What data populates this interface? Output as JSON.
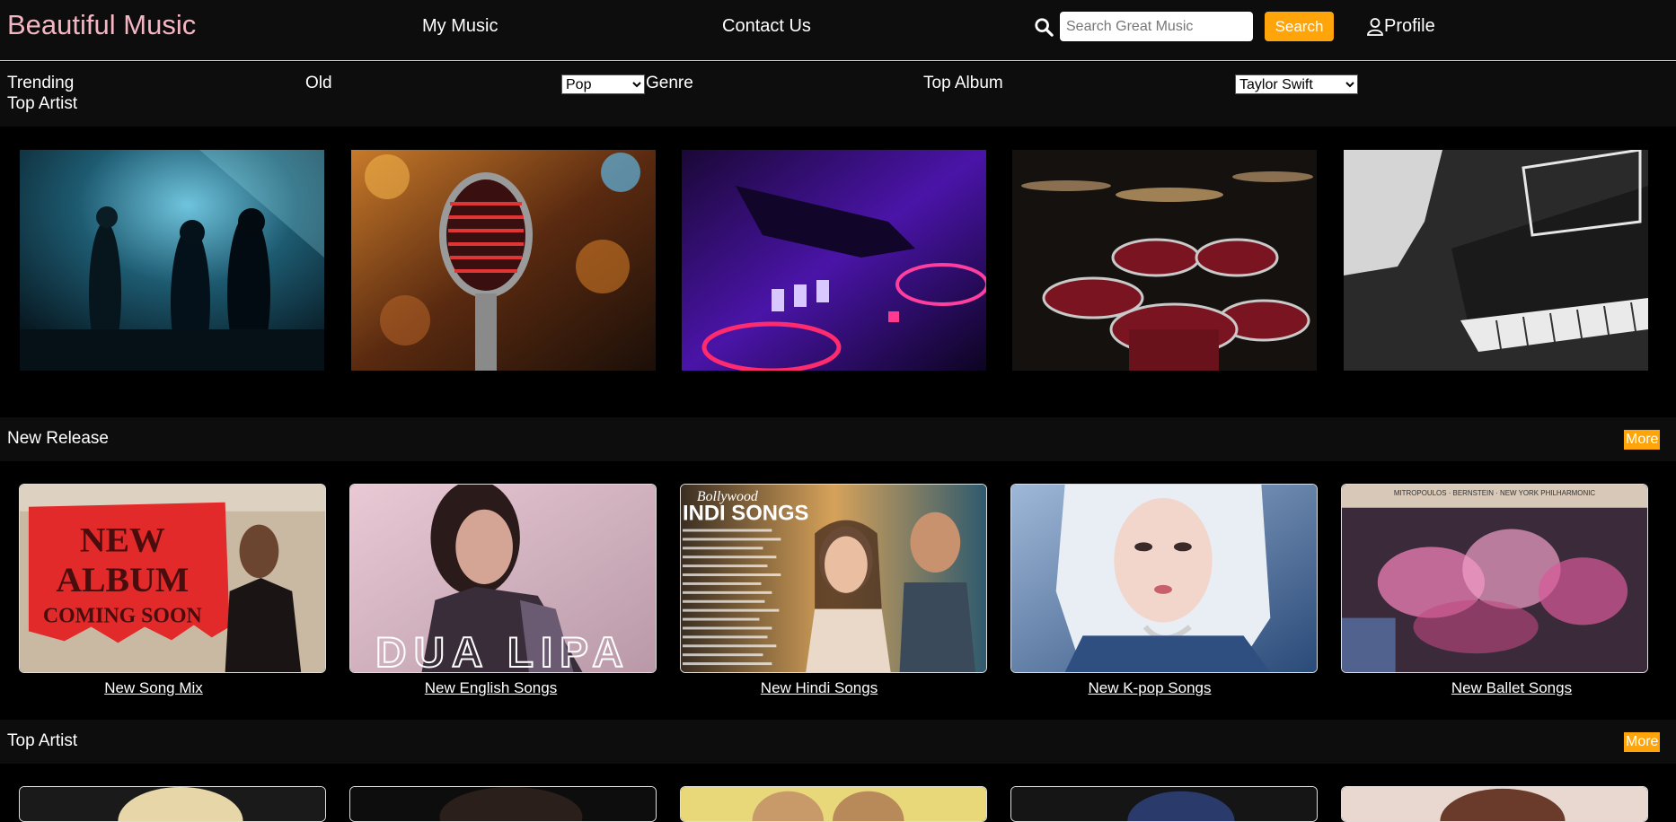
{
  "header": {
    "logo": "Beautiful Music",
    "nav": [
      "My Music",
      "Contact Us"
    ],
    "search_placeholder": "Search Great Music",
    "search_button": "Search",
    "profile": "Profile"
  },
  "categories": {
    "trending": "Trending",
    "top_artist": "Top Artist",
    "old": "Old",
    "genre_selected": "Pop",
    "genre": "Genre",
    "top_album": "Top Album",
    "artist_selected": "Taylor Swift"
  },
  "new_release": {
    "title": "New Release",
    "more": "More",
    "cards": [
      {
        "label": "New Song Mix",
        "art_text_1": "NEW",
        "art_text_2": "ALBUM",
        "art_text_3": "COMING SOON"
      },
      {
        "label": "New English Songs",
        "art_text": "DUA LIPA"
      },
      {
        "label": "New Hindi Songs",
        "art_text_1": "Bollywood",
        "art_text_2": "INDI SONGS"
      },
      {
        "label": "New K-pop Songs"
      },
      {
        "label": "New Ballet Songs",
        "art_text": "MITROPOULOS · BERNSTEIN · NEW YORK PHILHARMONIC"
      }
    ]
  },
  "top_artist": {
    "title": "Top Artist",
    "more": "More"
  },
  "colors": {
    "accent": "#ffa50a",
    "logo": "#f4b6c2",
    "bar": "#0d0d0d"
  }
}
